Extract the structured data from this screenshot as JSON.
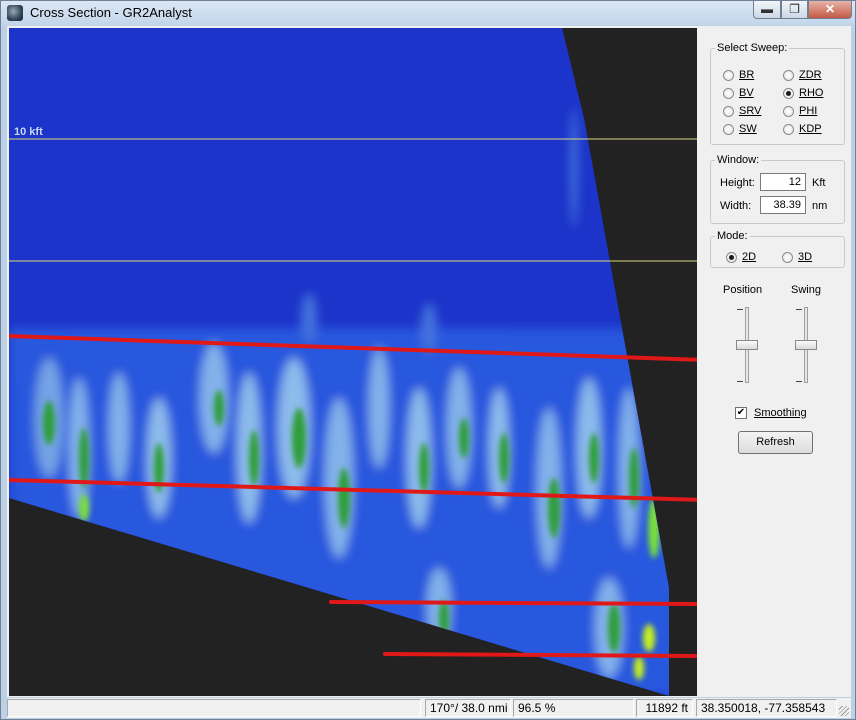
{
  "window": {
    "title": "Cross Section - GR2Analyst",
    "min_glyph": "▬",
    "max_glyph": "❐",
    "close_glyph": "✕"
  },
  "view": {
    "altitude_label": "10 kft"
  },
  "panel": {
    "sweep": {
      "legend": "Select Sweep:",
      "options": [
        "BR",
        "BV",
        "SRV",
        "SW",
        "ZDR",
        "RHO",
        "PHI",
        "KDP"
      ],
      "selected": "RHO"
    },
    "window_group": {
      "legend": "Window:",
      "height_label": "Height:",
      "height_value": "12",
      "height_unit": "Kft",
      "width_label": "Width:",
      "width_value": "38.39",
      "width_unit": "nm"
    },
    "mode": {
      "legend": "Mode:",
      "options": [
        "2D",
        "3D"
      ],
      "selected": "2D"
    },
    "position_label": "Position",
    "swing_label": "Swing",
    "smoothing_label": "Smoothing",
    "smoothing_checked": true,
    "refresh_label": "Refresh"
  },
  "status": {
    "azimuth_range": "170°/ 38.0 nmi",
    "percent": "96.5 %",
    "height_ft": "11892 ft",
    "coords": "38.350018, -77.358543"
  },
  "colors": {
    "background_fill": "#1c34c9",
    "no_data": "#222222",
    "annotation_red": "#e01818",
    "level_line": "#d8d880"
  }
}
